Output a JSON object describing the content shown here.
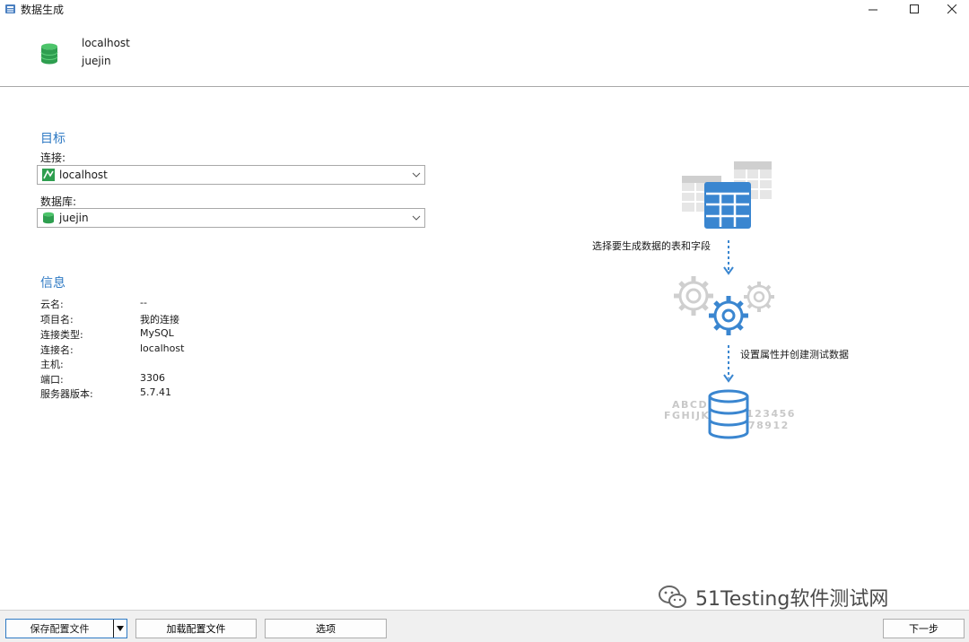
{
  "window": {
    "title": "数据生成"
  },
  "header": {
    "host": "localhost",
    "database": "juejin"
  },
  "target": {
    "section_title": "目标",
    "connection_label": "连接:",
    "connection_value": "localhost",
    "database_label": "数据库:",
    "database_value": "juejin"
  },
  "info": {
    "section_title": "信息",
    "rows": [
      {
        "key": "云名:",
        "value": "--"
      },
      {
        "key": "项目名:",
        "value": "我的连接"
      },
      {
        "key": "连接类型:",
        "value": "MySQL"
      },
      {
        "key": "连接名:",
        "value": "localhost"
      },
      {
        "key": "主机:",
        "value": ""
      },
      {
        "key": "端口:",
        "value": "3306"
      },
      {
        "key": "服务器版本:",
        "value": "5.7.41"
      }
    ]
  },
  "illustration": {
    "step1": "选择要生成数据的表和字段",
    "step2": "设置属性并创建测试数据",
    "letters_line1": "ABCD",
    "letters_line2": "FGHIJK",
    "digits_line1": "123456",
    "digits_line2": "78912"
  },
  "footer": {
    "save_config": "保存配置文件",
    "load_config": "加载配置文件",
    "options": "选项",
    "next": "下一步"
  },
  "watermark": {
    "text": "51Testing软件测试网"
  },
  "colors": {
    "accent": "#2f7ac4",
    "db_green": "#2e9e4f",
    "illus_blue": "#3a86d0",
    "illus_gray": "#c8c8c8"
  }
}
